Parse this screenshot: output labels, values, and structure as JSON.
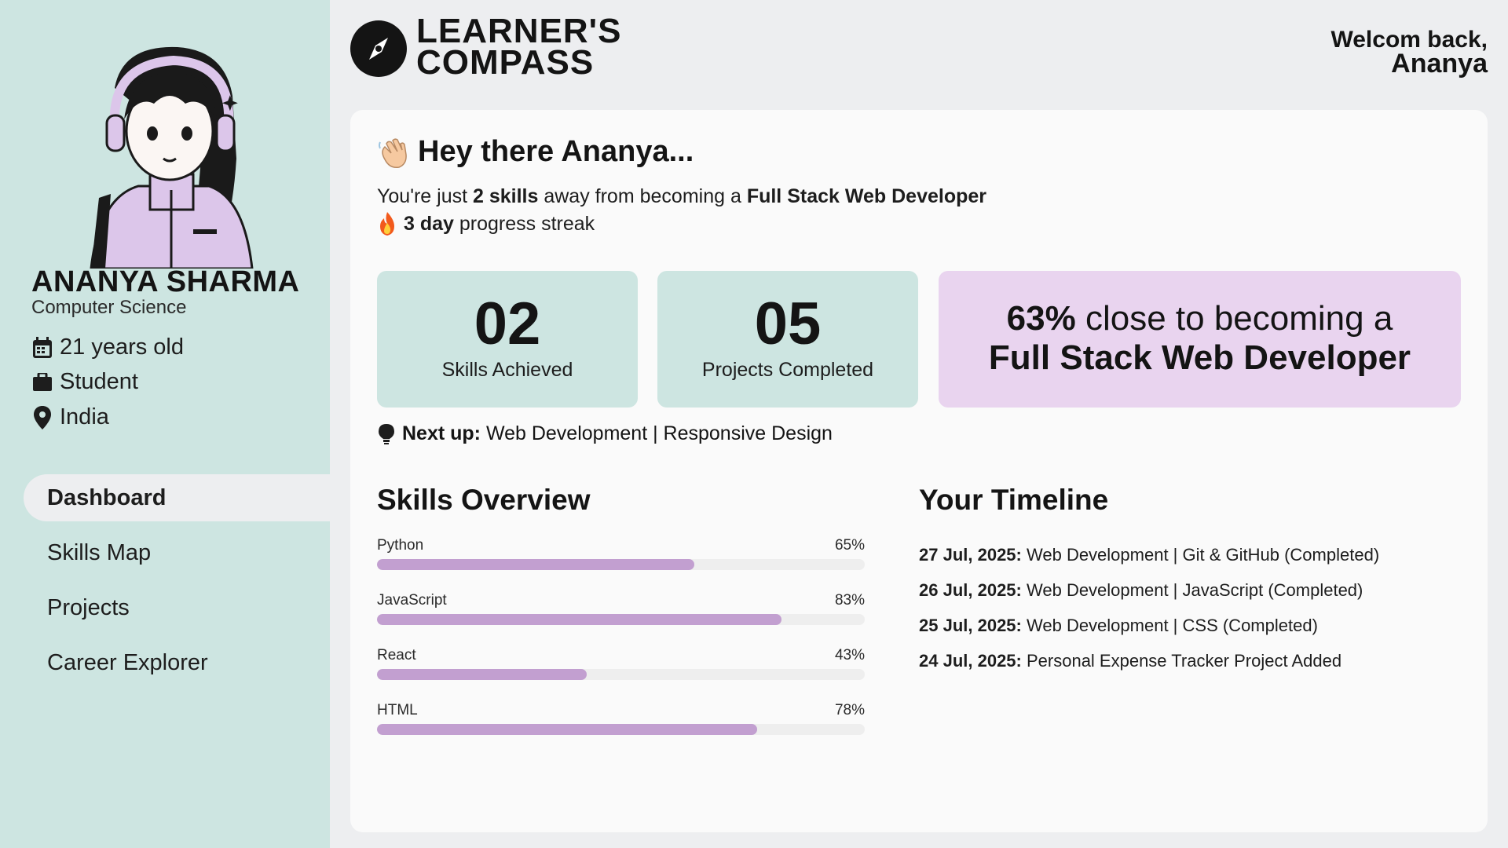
{
  "profile": {
    "name": "ANANYA SHARMA",
    "major": "Computer Science",
    "age": "21 years old",
    "occupation": "Student",
    "country": "India"
  },
  "nav": [
    {
      "label": "Dashboard",
      "active": true
    },
    {
      "label": "Skills Map",
      "active": false
    },
    {
      "label": "Projects",
      "active": false
    },
    {
      "label": "Career Explorer",
      "active": false
    }
  ],
  "brand": {
    "line1": "LEARNER'S",
    "line2": "COMPASS"
  },
  "welcome": {
    "greeting": "Welcom back,",
    "name": "Ananya"
  },
  "hero": {
    "greeting": "Hey there Ananya...",
    "line1_pre": "You're just ",
    "line1_skills": "2 skills",
    "line1_mid": " away from becoming a ",
    "line1_goal": "Full Stack Web Developer",
    "streak_days": "3 day",
    "streak_suffix": " progress streak"
  },
  "stats": [
    {
      "value": "02",
      "label": "Skills Achieved"
    },
    {
      "value": "05",
      "label": "Projects Completed"
    }
  ],
  "goal_progress": {
    "percent": "63%",
    "text": " close to becoming a",
    "goal": "Full Stack Web Developer",
    "fraction": 0.63
  },
  "next_up": {
    "label": "Next up:",
    "value": " Web Development | Responsive Design"
  },
  "skills_overview": {
    "title": "Skills Overview",
    "items": [
      {
        "name": "Python",
        "percent_label": "65%",
        "value": 65
      },
      {
        "name": "JavaScript",
        "percent_label": "83%",
        "value": 83
      },
      {
        "name": "React",
        "percent_label": "43%",
        "value": 43
      },
      {
        "name": "HTML",
        "percent_label": "78%",
        "value": 78
      }
    ]
  },
  "timeline": {
    "title": "Your Timeline",
    "items": [
      {
        "date": "27 Jul, 2025:",
        "text": " Web Development | Git & GitHub (Completed)"
      },
      {
        "date": "26 Jul, 2025:",
        "text": " Web Development | JavaScript (Completed)"
      },
      {
        "date": "25 Jul, 2025:",
        "text": " Web Development | CSS (Completed)"
      },
      {
        "date": "24 Jul, 2025:",
        "text": " Personal Expense Tracker Project Added"
      }
    ]
  },
  "icons": {
    "calendar": "calendar-icon",
    "briefcase": "briefcase-icon",
    "location": "location-pin-icon",
    "logo": "compass-icon",
    "wave": "waving-hand-icon",
    "flame": "fire-icon",
    "bulb": "lightbulb-icon"
  },
  "colors": {
    "sidebar": "#cde5e1",
    "stat_card": "#cde5e1",
    "goal_card": "#e9d4ef",
    "bar_fill": "#c29fd0"
  }
}
